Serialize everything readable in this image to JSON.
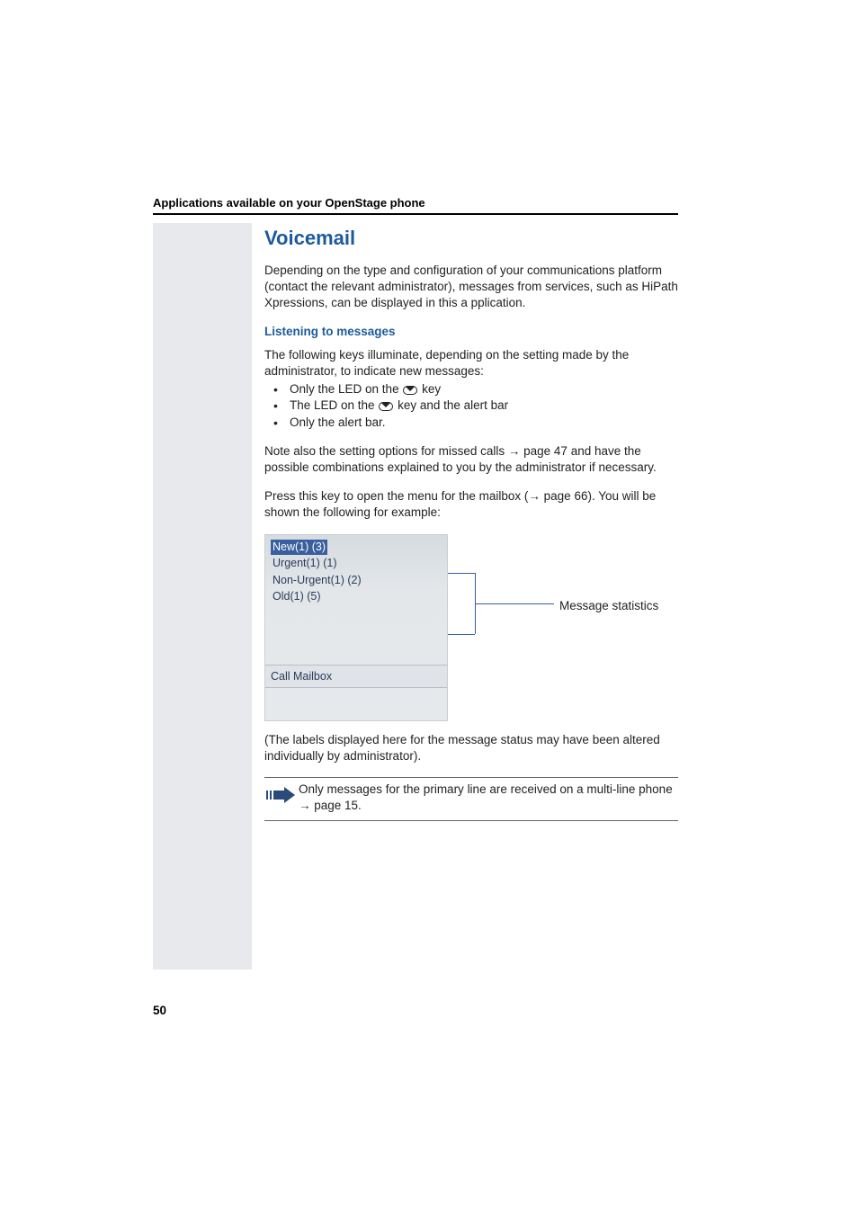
{
  "header": {
    "running_title": "Applications available on your OpenStage phone"
  },
  "section": {
    "title": "Voicemail",
    "intro": "Depending on the type and configuration of your communications platform (contact the relevant administrator), messages from services, such as HiPath Xpressions, can be displayed in this a  pplication.",
    "subhead": "Listening to messages",
    "keys_intro": "The following keys illuminate, depending on the setting made by the administrator, to indicate new messages:",
    "bullets": {
      "b1_pre": "Only the LED on the ",
      "b1_post": " key",
      "b2_pre": "The LED on the ",
      "b2_post": " key and the alert bar",
      "b3": "Only the alert bar."
    },
    "note_missed_pre": "Note also the setting options for missed calls ",
    "note_missed_arrow": "→",
    "note_missed_post": " page 47 and have the possible combinations explained to you by the administrator if necessary.",
    "press_pre": "Press this key to open the menu for the mailbox (",
    "press_arrow": "→",
    "press_post": " page 66). You will be shown the following for example:",
    "screen": {
      "items": [
        "New(1) (3)",
        "Urgent(1) (1)",
        "Non-Urgent(1) (2)",
        "Old(1) (5)"
      ],
      "action": "Call Mailbox"
    },
    "stat_label": "Message statistics",
    "labels_note": "(The labels displayed here for the message status may have been altered individually by administrator).",
    "multiline_pre": "Only messages for the primary line are received on a multi-line phone ",
    "multiline_arrow": "→",
    "multiline_post": " page 15."
  },
  "page_number": "50"
}
